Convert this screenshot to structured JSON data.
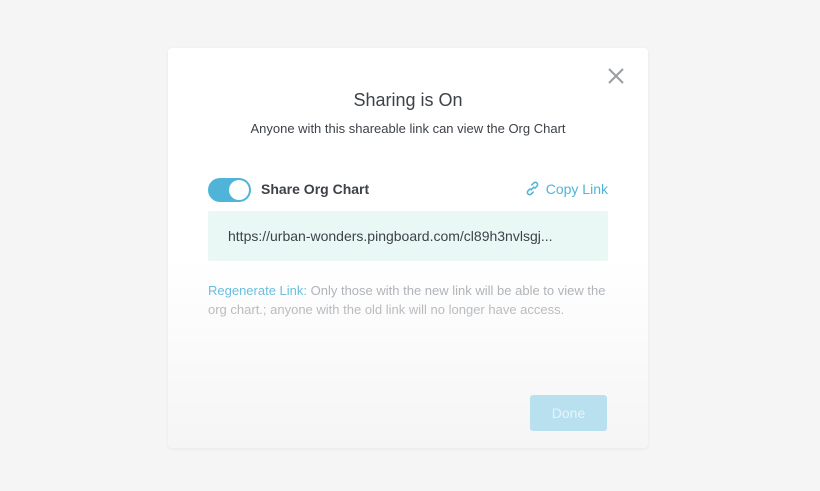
{
  "modal": {
    "title": "Sharing is On",
    "subtitle": "Anyone with this shareable link can view the Org Chart",
    "close_icon": "close-icon"
  },
  "share": {
    "toggle_label": "Share Org Chart",
    "toggle_on": true,
    "copy_link_label": "Copy Link",
    "copy_icon": "link-icon",
    "link_url": "https://urban-wonders.pingboard.com/cl89h3nvlsgj..."
  },
  "regenerate": {
    "link_label": "Regenerate Link:",
    "description": " Only those with the new link will be able to view the org chart.; anyone with the old link will no longer have access."
  },
  "footer": {
    "done_label": "Done"
  },
  "colors": {
    "accent": "#4fb4d8",
    "link_box_bg": "#e9f8f4",
    "text": "#3d4248",
    "muted_text": "#a2a6aa",
    "page_bg": "#f5f5f6"
  }
}
